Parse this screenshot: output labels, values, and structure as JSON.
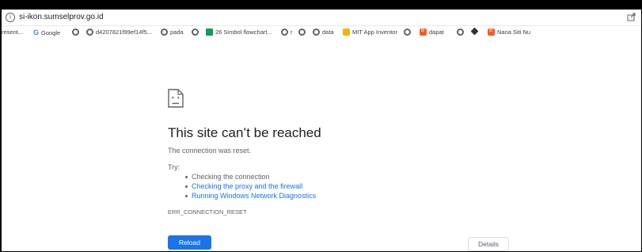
{
  "address_bar": {
    "url": "si-ikon.sumselprov.go.id",
    "info_icon": "info-icon",
    "share_icon": "share-icon"
  },
  "bookmarks": [
    {
      "label": "resent...",
      "icon": ""
    },
    {
      "label": "Google",
      "icon": "google-icon"
    },
    {
      "label": "",
      "icon": "globe-icon"
    },
    {
      "label": "d4207821f99ef14f5...",
      "icon": "globe-icon"
    },
    {
      "label": "pada",
      "icon": "globe-icon"
    },
    {
      "label": "",
      "icon": "globe-icon"
    },
    {
      "label": "26 Simbol flowchart...",
      "icon": "chart-icon"
    },
    {
      "label": "r",
      "icon": "globe-icon"
    },
    {
      "label": "",
      "icon": "globe-icon"
    },
    {
      "label": "data",
      "icon": "globe-icon"
    },
    {
      "label": "MIT App Inventor",
      "icon": "mit-icon"
    },
    {
      "label": "",
      "icon": "globe-icon"
    },
    {
      "label": "dapat",
      "icon": "blogger-icon"
    },
    {
      "label": "",
      "icon": "globe-icon"
    },
    {
      "label": "",
      "icon": "bookmark-icon"
    },
    {
      "label": "Nana Siti Nu",
      "icon": "blogger-icon"
    }
  ],
  "error": {
    "icon": "sad-page-icon",
    "title": "This site can’t be reached",
    "message": "The connection was reset.",
    "try_label": "Try:",
    "suggestions": [
      "Checking the connection",
      "Checking the proxy and the firewall",
      "Running Windows Network Diagnostics"
    ],
    "error_code": "ERR_CONNECTION_RESET",
    "reload_label": "Reload",
    "details_label": "Details"
  },
  "colors": {
    "accent": "#1a73e8",
    "text": "#202124",
    "secondary_text": "#5f6368"
  }
}
